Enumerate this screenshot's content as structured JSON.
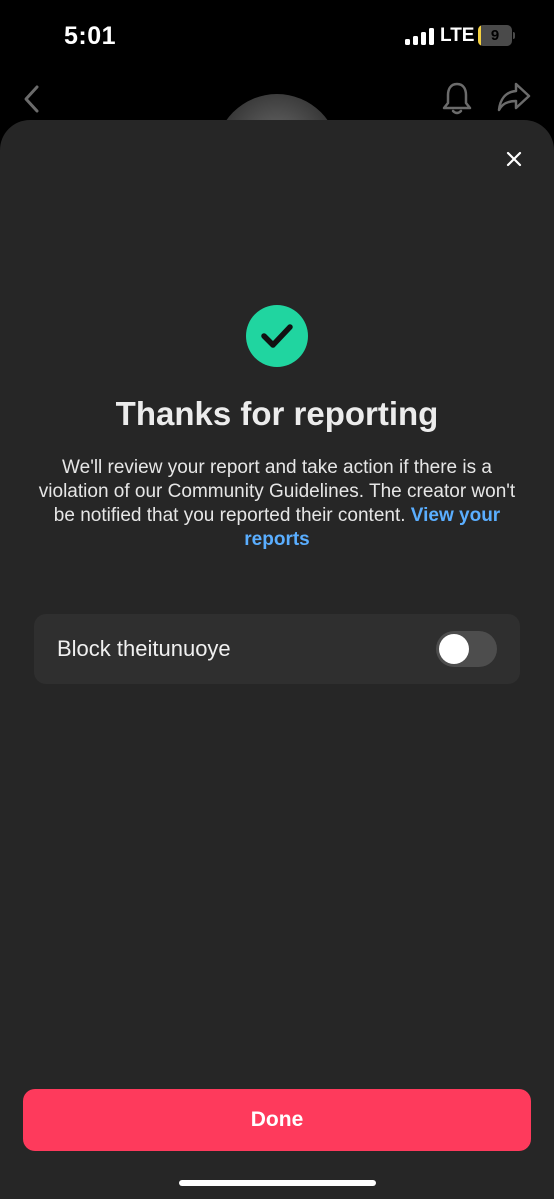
{
  "status_bar": {
    "time": "5:01",
    "network": "LTE",
    "battery_level": "9",
    "battery_fraction": 0.09
  },
  "header": {
    "icons": [
      "back-icon",
      "bell-icon",
      "share-icon"
    ]
  },
  "sheet": {
    "title": "Thanks for reporting",
    "message": "We'll review your report and take action if there is a violation of our Community Guidelines. The creator won't be notified that you reported their content.",
    "link_text": "View your reports",
    "block_label": "Block theitunuoye",
    "block_enabled": false,
    "done_label": "Done"
  },
  "colors": {
    "accent": "#fe3a5c",
    "success": "#20d5a0",
    "link": "#5aaeff",
    "sheet_background": "#262626",
    "battery": "#f4d03f"
  }
}
